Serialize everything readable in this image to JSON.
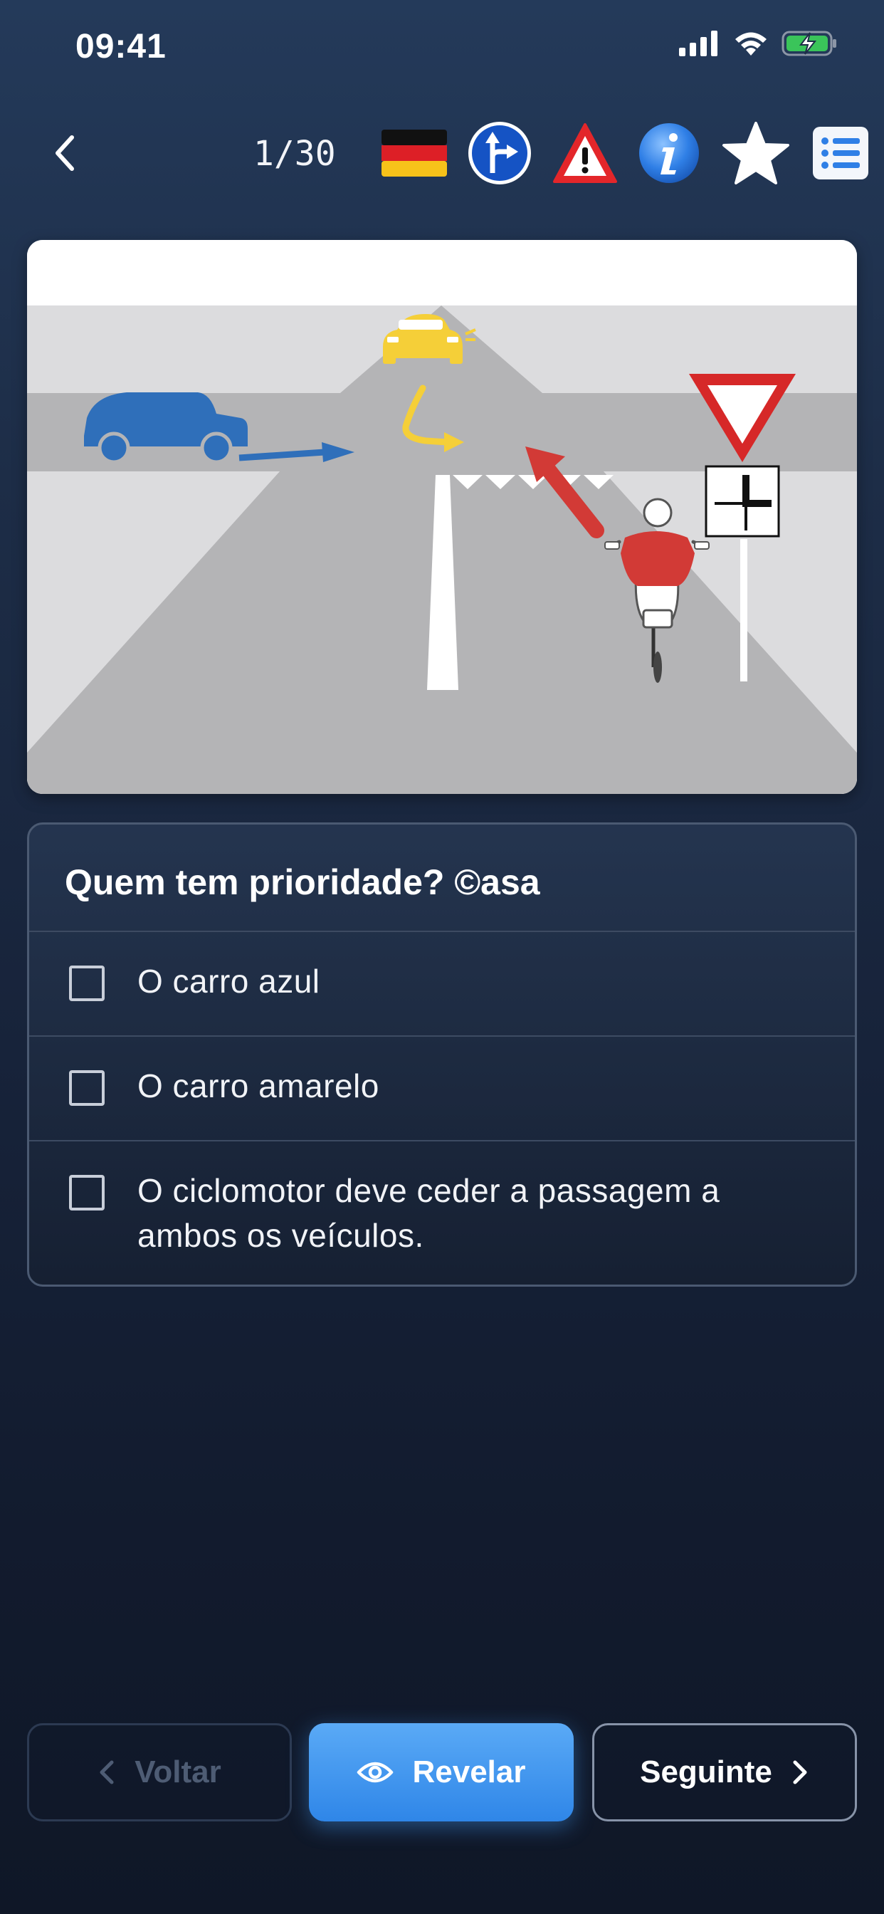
{
  "status": {
    "time": "09:41"
  },
  "header": {
    "counter": "1/30"
  },
  "toolbar_icons": [
    "german-flag-icon",
    "direction-sign-icon",
    "warning-triangle-icon",
    "info-icon",
    "star-icon",
    "list-icon"
  ],
  "question": {
    "title": "Quem tem prioridade? ©asa",
    "options": [
      {
        "label": "O carro azul"
      },
      {
        "label": "O carro amarelo"
      },
      {
        "label_line1": "O ciclomotor deve ceder a passagem a",
        "label_line2": "ambos os veículos."
      }
    ]
  },
  "footer": {
    "back_label": "Voltar",
    "reveal_label": "Revelar",
    "next_label": "Seguinte"
  },
  "colors": {
    "accent": "#3f95ef",
    "background_top": "#243a5a",
    "background_bottom": "#0f1727",
    "blue_car": "#2f6fba",
    "yellow_car": "#f5cf38",
    "moped_rider": "#d23a36"
  }
}
